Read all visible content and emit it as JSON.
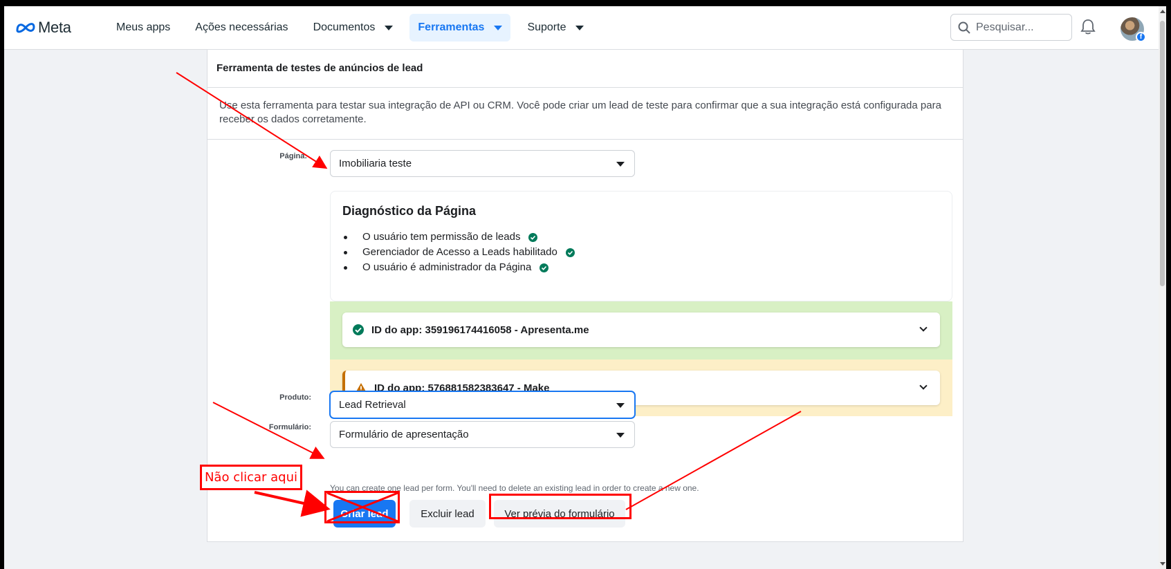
{
  "header": {
    "brand": "Meta",
    "nav": [
      {
        "label": "Meus apps",
        "dropdown": false,
        "active": false
      },
      {
        "label": "Ações necessárias",
        "dropdown": false,
        "active": false
      },
      {
        "label": "Documentos",
        "dropdown": true,
        "active": false
      },
      {
        "label": "Ferramentas",
        "dropdown": true,
        "active": true
      },
      {
        "label": "Suporte",
        "dropdown": true,
        "active": false
      }
    ],
    "search_placeholder": "Pesquisar...",
    "accent": "#1877f2"
  },
  "card": {
    "title": "Ferramenta de testes de anúncios de lead",
    "description": "Use esta ferramenta para testar sua integração de API ou CRM. Você pode criar um lead de teste para confirmar que a sua integração está configurada para receber os dados corretamente.",
    "page_label": "Página:",
    "page_value": "Imobiliaria teste",
    "diagnostics": {
      "title": "Diagnóstico da Página",
      "items": [
        "O usuário tem permissão de leads",
        "Gerenciador de Acesso a Leads habilitado",
        "O usuário é administrador da Página"
      ]
    },
    "apps": [
      {
        "label": "ID do app: 359196174416058 - Apresenta.me",
        "status": "ok"
      },
      {
        "label": "ID do app: 576881582383647 - Make",
        "status": "warning"
      }
    ],
    "product_label": "Produto:",
    "product_value": "Lead Retrieval",
    "form_label": "Formulário:",
    "form_value": "Formulário de apresentação",
    "note": "You can create one lead per form. You'll need to delete an existing lead in order to create a new one.",
    "buttons": {
      "create": "Criar lead",
      "delete": "Excluir lead",
      "preview": "Ver prévia do formulário"
    }
  },
  "annotation": {
    "label": "Não clicar aqui",
    "color": "#ff0000"
  }
}
